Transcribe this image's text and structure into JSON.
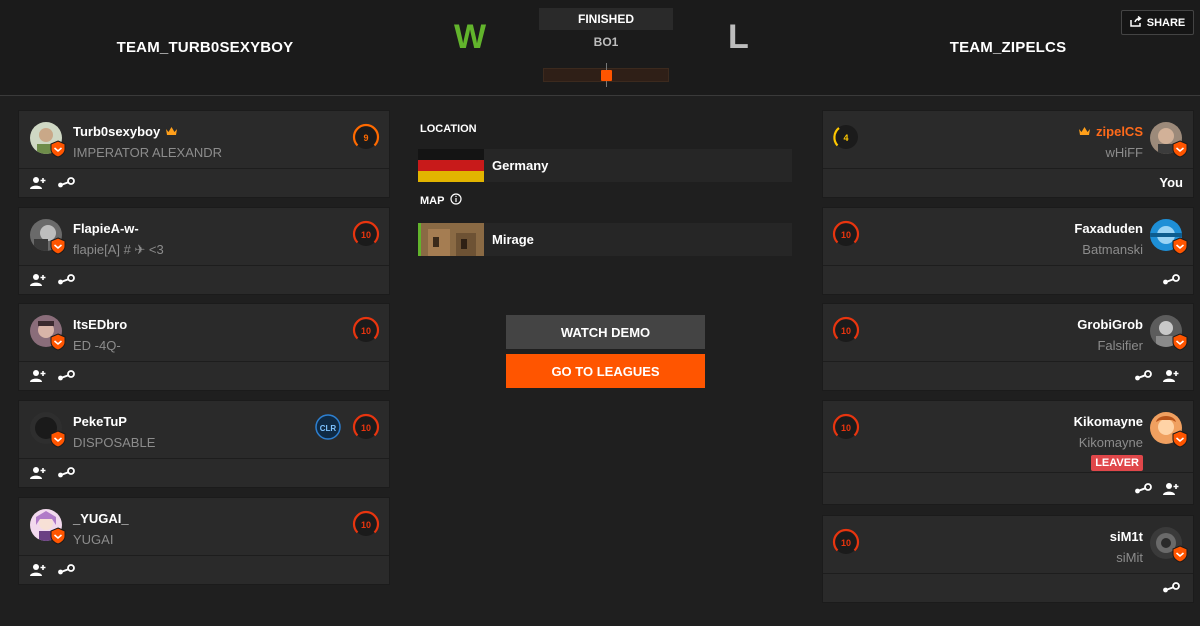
{
  "match": {
    "team_left": "TEAM_TURB0SEXYBOY",
    "team_right": "TEAM_ZIPELCS",
    "result_left": "W",
    "result_right": "L",
    "status": "FINISHED",
    "format": "BO1",
    "share_label": "SHARE"
  },
  "players_left": [
    {
      "name": "Turb0sexyboy",
      "sub": "IMPERATOR ALEXANDR",
      "level": "9",
      "leader": true
    },
    {
      "name": "FlapieA-w-",
      "sub": "flapie[A] # ✈ <3",
      "level": "10"
    },
    {
      "name": "ItsEDbro",
      "sub": "ED -4Q-",
      "level": "10"
    },
    {
      "name": "PekeTuP",
      "sub": "DISPOSABLE",
      "level": "10",
      "badge": "CLR"
    },
    {
      "name": "_YUGAI_",
      "sub": "YUGAI",
      "level": "10"
    }
  ],
  "players_right": [
    {
      "name": "zipelCS",
      "sub": "wHiFF",
      "level": "4",
      "leader": true,
      "you_label": "You"
    },
    {
      "name": "Faxaduden",
      "sub": "Batmanski",
      "level": "10"
    },
    {
      "name": "GrobiGrob",
      "sub": "Falsifier",
      "level": "10"
    },
    {
      "name": "Kikomayne",
      "sub": "Kikomayne",
      "level": "10",
      "tag": "LEAVER"
    },
    {
      "name": "siM1t",
      "sub": "siMit",
      "level": "10"
    }
  ],
  "center": {
    "location_label": "LOCATION",
    "location": "Germany",
    "map_label": "MAP",
    "map": "Mirage",
    "watch_demo": "WATCH DEMO",
    "go_to_leagues": "GO TO LEAGUES"
  },
  "colors": {
    "accent": "#ff5500",
    "win": "#62b42c",
    "level_10": "#e8350f",
    "level_9": "#ff6a00",
    "level_4": "#ffc800",
    "leaver": "#e0474a"
  },
  "icons": [
    "share-icon",
    "crown-icon",
    "add-friend-icon",
    "steam-icon",
    "shield-icon",
    "info-icon",
    "skill-level-icon"
  ]
}
